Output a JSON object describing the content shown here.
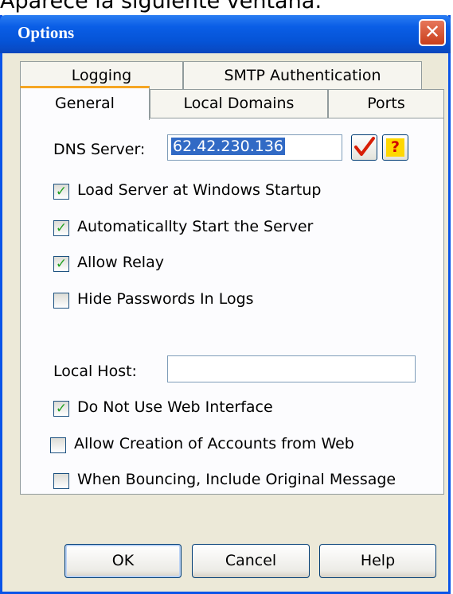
{
  "caption": "Aparece la siguiente ventana:",
  "window": {
    "title": "Options",
    "close_glyph": "✕"
  },
  "tabs": {
    "row1": [
      {
        "label": "Logging",
        "mnemonic": "o"
      },
      {
        "label": "SMTP Authentication",
        "mnemonic": "S"
      }
    ],
    "row2": [
      {
        "label": "General",
        "mnemonic": "G",
        "selected": true
      },
      {
        "label": "Local Domains",
        "mnemonic": "L"
      },
      {
        "label": "Ports",
        "mnemonic": "P"
      }
    ]
  },
  "general": {
    "dns_label": "DNS Server:",
    "dns_value": "62.42.230.136",
    "check_button_icon": "red-checkmark-icon",
    "help_button_icon": "question-mark-icon",
    "help_glyph": "?",
    "checkboxes": [
      {
        "label": "Load Server at Windows Startup",
        "checked": true
      },
      {
        "label": "Automaticallty Start the Server",
        "checked": true
      },
      {
        "label": "Allow Relay",
        "checked": true
      },
      {
        "label": "Hide Passwords In Logs",
        "checked": false
      }
    ],
    "local_host_label": "Local Host:",
    "local_host_value": "",
    "checkboxes2": [
      {
        "label": "Do Not Use Web Interface",
        "checked": true
      },
      {
        "label": "Allow Creation of Accounts from Web",
        "checked": false
      },
      {
        "label": "When Bouncing, Include Original Message",
        "checked": false
      }
    ]
  },
  "buttons": {
    "ok": "OK",
    "cancel": "Cancel",
    "help": "Help"
  },
  "colors": {
    "titlebar": "#0a5ee6",
    "dialog_bg": "#ece9d8",
    "tab_accent": "#f5a623",
    "check_green": "#21a121",
    "selection": "#316ac5"
  }
}
